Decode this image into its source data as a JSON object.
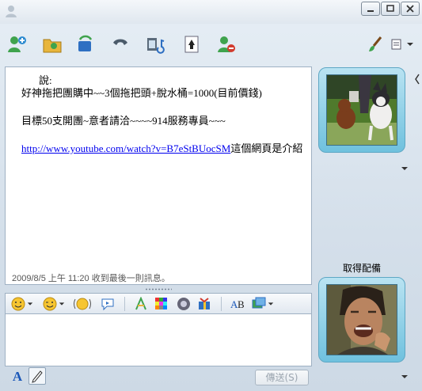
{
  "window": {
    "controls": [
      "minimize",
      "maximize",
      "close"
    ]
  },
  "toolbar": {
    "icons": [
      "invite-contact-icon",
      "share-files-icon",
      "video-call-icon",
      "voice-call-icon",
      "activities-icon",
      "games-icon",
      "block-contact-icon",
      "paint-brush-icon",
      "show-menu-icon"
    ]
  },
  "conversation": {
    "sender_suffix": "說:",
    "message_line_1": "好神拖把團購中~~3個拖把頭+脫水桶=1000(目前價錢)",
    "message_line_2": "目標50支開團~意者請洽~~~~914服務專員~~~",
    "link_text": "http://www.youtube.com/watch?v=B7eStBUocSM",
    "link_suffix": "這個網頁是介紹",
    "status": "2009/8/5 上午 11:20 收到最後一則訊息。"
  },
  "format_toolbar": {
    "icons": [
      "emoticon-icon",
      "wink-icon",
      "nudge-icon",
      "voice-clip-icon",
      "font-icon",
      "background-icon",
      "sound-icon",
      "gift-icon",
      "translate-icon",
      "snapshot-icon"
    ]
  },
  "compose": {
    "value": "",
    "send_label": "傳送(S)"
  },
  "right_panel": {
    "self_caption": "取得配備"
  },
  "colors": {
    "link": "#0000ee",
    "frame": "#7cc6e0",
    "status_text": "#555555"
  }
}
